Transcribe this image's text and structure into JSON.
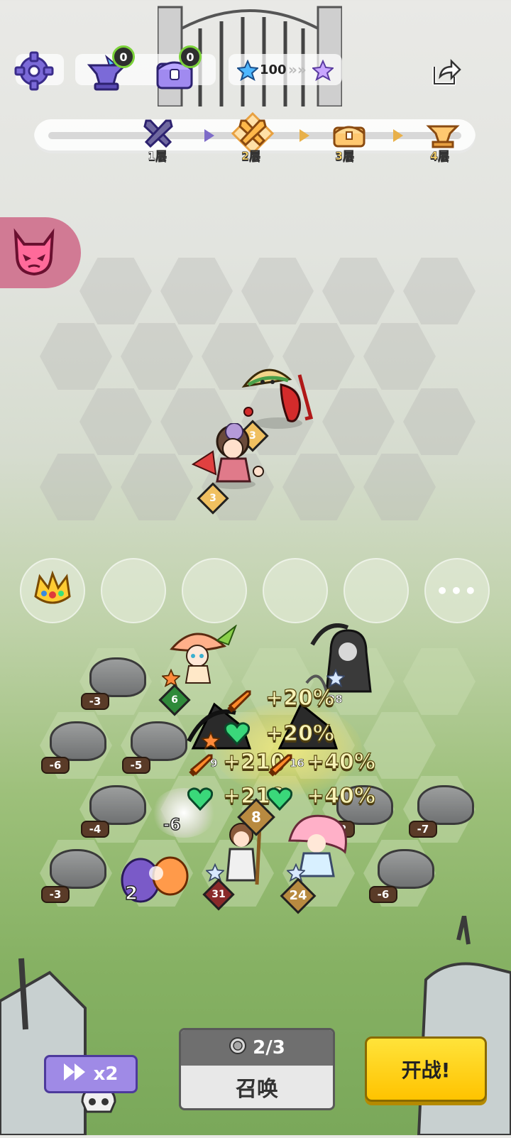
{
  "top_bar": {
    "anvil_count": "0",
    "chest_count": "0",
    "star_value": "100",
    "star_arrows": "»»"
  },
  "floors": [
    {
      "label": "1层",
      "state": "done"
    },
    {
      "label": "2层",
      "state": "current"
    },
    {
      "label": "3层",
      "state": "reward"
    },
    {
      "label": "4层",
      "state": "boss"
    }
  ],
  "enemies": [
    {
      "name": "taco-pepper-enemy",
      "level": "3"
    },
    {
      "name": "fan-girl-enemy",
      "level": "3"
    }
  ],
  "rocks": [
    "-3",
    "-6",
    "-5",
    "-4",
    "-6",
    "-2",
    "-7",
    "-3",
    "-6"
  ],
  "units": [
    {
      "name": "mushroom-girl",
      "level": "6"
    },
    {
      "name": "grim-reaper",
      "level": "28"
    },
    {
      "name": "witch-left",
      "level": "9"
    },
    {
      "name": "witch-right",
      "level": "16"
    },
    {
      "name": "staff-boy",
      "level": "31",
      "power": "8"
    },
    {
      "name": "pink-hair-girl",
      "power": "24"
    },
    {
      "name": "purple-egg",
      "power": "2"
    }
  ],
  "buffs": {
    "row1": "+20%",
    "row2": "+20%",
    "row3_left": "+210",
    "row3_right": "+40%",
    "row4_left": "+210",
    "row4_right": "+40%",
    "mid_count": "-6"
  },
  "bench_more": "•••",
  "bottom": {
    "speed_label": "x2",
    "summon_count": "2/3",
    "summon_label": "召唤",
    "fight_label": "开战!"
  },
  "colors": {
    "fight_button": "#ffc300",
    "speed_button": "#9f8ae6",
    "demon_tab": "#e05a8a"
  }
}
